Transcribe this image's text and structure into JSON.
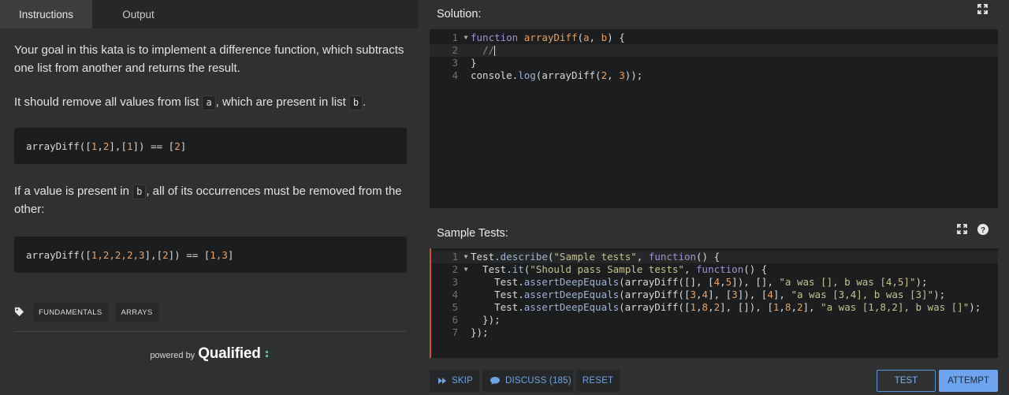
{
  "tabs": [
    {
      "label": "Instructions",
      "active": true
    },
    {
      "label": "Output",
      "active": false
    }
  ],
  "description": {
    "p1": "Your goal in this kata is to implement a difference function, which subtracts one list from another and returns the result.",
    "p2_before": "It should remove all values from list ",
    "p2_code_a": "a",
    "p2_middle": ", which are present in list ",
    "p2_code_b": "b",
    "p2_after": ".",
    "example1": {
      "prefix": "arrayDiff([",
      "n1": "1",
      "c1": ",",
      "n2": "2",
      "mid": "],[",
      "n3": "1",
      "suffix": "]) == [",
      "n4": "2",
      "end": "]"
    },
    "p3_before": "If a value is present in ",
    "p3_code": "b",
    "p3_after": ", all of its occurrences must be removed from the other:",
    "example2": {
      "prefix": "arrayDiff([",
      "nums": "1,2,2,2,3",
      "mid": "],[",
      "n2": "2",
      "suffix": "]) == [",
      "r": "1,3",
      "end": "]"
    },
    "tags": [
      "FUNDAMENTALS",
      "ARRAYS"
    ],
    "powered_by": "powered by",
    "brand": "Qualified"
  },
  "solution": {
    "title": "Solution:",
    "lines": [
      "1",
      "2",
      "3",
      "4"
    ]
  },
  "sample_tests": {
    "title": "Sample Tests:",
    "lines": [
      "1",
      "2",
      "3",
      "4",
      "5",
      "6",
      "7"
    ]
  },
  "buttons": {
    "skip": "SKIP",
    "discuss": "DISCUSS (185)",
    "reset": "RESET",
    "test": "TEST",
    "attempt": "ATTEMPT"
  },
  "colors": {
    "accent": "#6ea3ee",
    "keyword": "#a68ed2",
    "string": "#c7c08f",
    "number": "#e6a164",
    "brand_dots": "#2fcf7c",
    "error_marker": "#c8523c"
  }
}
